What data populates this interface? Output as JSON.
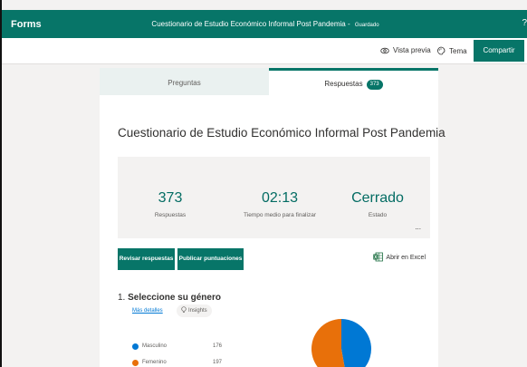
{
  "header": {
    "app_name": "Forms",
    "doc_title": "Cuestionario de Estudio Económico Informal Post Pandemia",
    "separator": " - ",
    "save_status": "Guardado",
    "help": "?"
  },
  "toolbar": {
    "preview_label": "Vista previa",
    "theme_label": "Tema",
    "share_label": "Compartir"
  },
  "tabs": {
    "questions_label": "Preguntas",
    "responses_label": "Respuestas",
    "responses_count": "373"
  },
  "form": {
    "title": "Cuestionario de Estudio Económico Informal Post Pandemia"
  },
  "stats": [
    {
      "value": "373",
      "label": "Respuestas"
    },
    {
      "value": "02:13",
      "label": "Tiempo medio para finalizar"
    },
    {
      "value": "Cerrado",
      "label": "Estado"
    }
  ],
  "stats_more": "...",
  "actions": {
    "review_label": "Revisar respuestas",
    "publish_label": "Publicar puntuaciones",
    "excel_label": "Abrir en Excel"
  },
  "question": {
    "number": "1.",
    "title": "Seleccione su género",
    "more_details": "Más detalles",
    "insights": "Insights"
  },
  "chart_data": {
    "type": "pie",
    "categories": [
      "Masculino",
      "Femenino"
    ],
    "values": [
      176,
      197
    ],
    "colors": [
      "#0078d4",
      "#e8700a"
    ]
  }
}
